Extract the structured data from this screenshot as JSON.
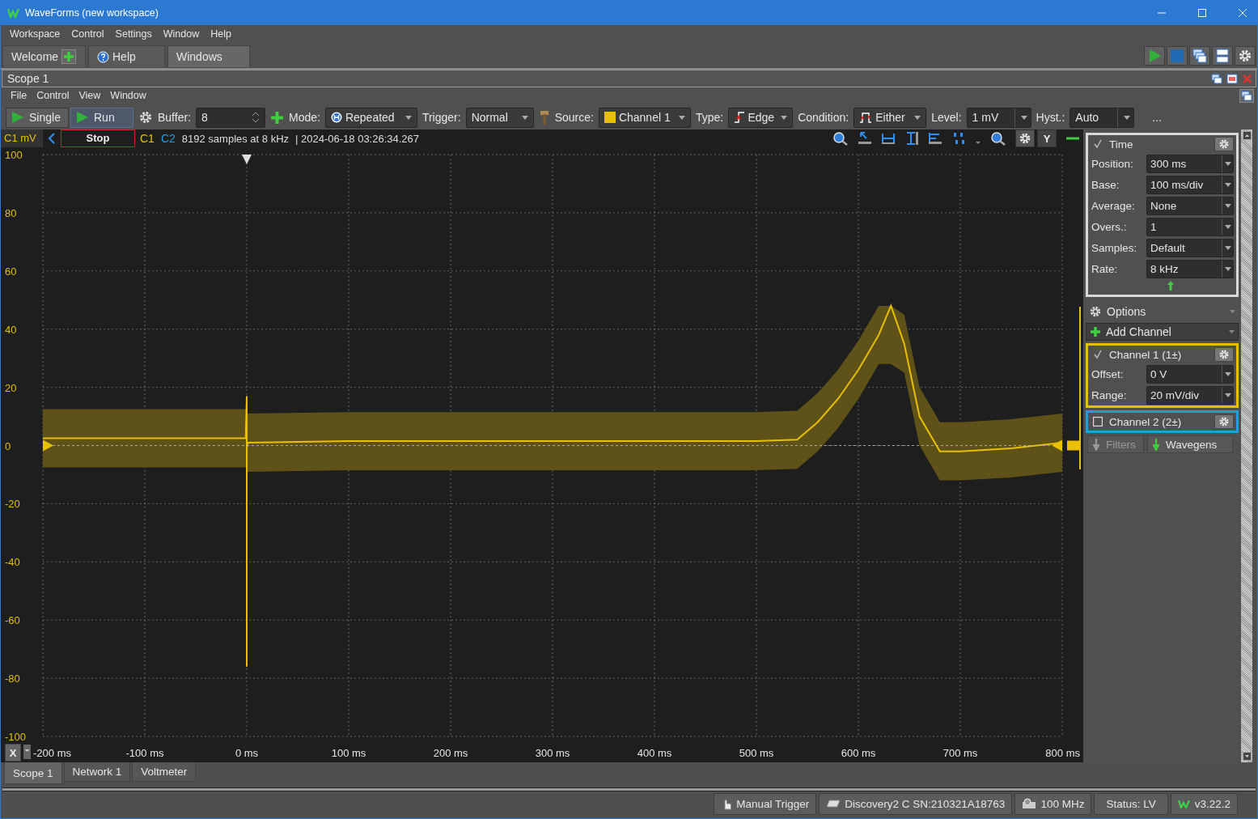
{
  "window": {
    "title": "WaveForms (new workspace)"
  },
  "menu": [
    "Workspace",
    "Control",
    "Settings",
    "Window",
    "Help"
  ],
  "tabs": [
    {
      "label": "Welcome",
      "selected": false,
      "kind": "add"
    },
    {
      "label": "Help",
      "selected": false,
      "kind": "help"
    },
    {
      "label": "Windows",
      "selected": true,
      "kind": "plain"
    }
  ],
  "scope": {
    "title": "Scope 1",
    "menu": [
      "File",
      "Control",
      "View",
      "Window"
    ],
    "toolbar": {
      "single": "Single",
      "run": "Run",
      "buffer_label": "Buffer:",
      "buffer": "8",
      "mode_label": "Mode:",
      "mode": "Repeated",
      "trigger_label": "Trigger:",
      "trigger": "Normal",
      "source_label": "Source:",
      "source": "Channel 1",
      "type_label": "Type:",
      "type": "Edge",
      "condition_label": "Condition:",
      "condition": "Either",
      "level_label": "Level:",
      "level_value": "1 mV",
      "hyst_label": "Hyst.:",
      "hyst": "Auto",
      "more": "..."
    },
    "info": {
      "status": "Stop",
      "channels": [
        {
          "label": "C1",
          "color": "#e8c000"
        },
        {
          "label": "C2",
          "color": "#1ba1e2"
        }
      ],
      "samples": "8192 samples at 8 kHz",
      "timestamp": "| 2024-06-18 03:26:34.267",
      "y_button": "Y",
      "x_button": "X"
    },
    "chart_data": {
      "type": "line",
      "ylabel": "C1 mV",
      "grid": true,
      "ref_lines": [
        {
          "axis": "y",
          "value": 0
        }
      ],
      "xlim": [
        -200,
        800
      ],
      "ylim": [
        -100,
        100
      ],
      "xticks": [
        {
          "value": -200,
          "label": "-200 ms"
        },
        {
          "value": -100,
          "label": "-100 ms"
        },
        {
          "value": 0,
          "label": "0 ms"
        },
        {
          "value": 100,
          "label": "100 ms"
        },
        {
          "value": 200,
          "label": "200 ms"
        },
        {
          "value": 300,
          "label": "300 ms"
        },
        {
          "value": 400,
          "label": "400 ms"
        },
        {
          "value": 500,
          "label": "500 ms"
        },
        {
          "value": 600,
          "label": "600 ms"
        },
        {
          "value": 700,
          "label": "700 ms"
        },
        {
          "value": 800,
          "label": "800 ms"
        }
      ],
      "yticks": [
        100,
        80,
        60,
        40,
        20,
        0,
        -20,
        -40,
        -60,
        -80,
        -100
      ],
      "x": [
        -200,
        -100,
        -1,
        0,
        0,
        0,
        1,
        100,
        200,
        300,
        400,
        500,
        540,
        560,
        580,
        600,
        620,
        632,
        645,
        660,
        680,
        700,
        750,
        800
      ],
      "series": [
        {
          "color": "#e8c000",
          "values": [
            2.5,
            2.5,
            2.5,
            17,
            -76,
            -1,
            1,
            1.5,
            1.5,
            1.5,
            1.5,
            1.5,
            2,
            8,
            16,
            26,
            38,
            48,
            35,
            10,
            -2,
            -2,
            -1,
            1
          ]
        }
      ]
    },
    "panel": {
      "time": {
        "title": "Time",
        "checked": true,
        "fields": [
          {
            "label": "Position:",
            "value": "300 ms"
          },
          {
            "label": "Base:",
            "value": "100 ms/div"
          },
          {
            "label": "Average:",
            "value": "None"
          },
          {
            "label": "Overs.:",
            "value": "1"
          },
          {
            "label": "Samples:",
            "value": "Default"
          },
          {
            "label": "Rate:",
            "value": "8 kHz"
          }
        ]
      },
      "options": "Options",
      "add_channel": "Add Channel",
      "channels": [
        {
          "title": "Channel 1 (1±)",
          "checked": true,
          "color": "#e8c000",
          "fields": [
            {
              "label": "Offset:",
              "value": "0 V"
            },
            {
              "label": "Range:",
              "value": "20 mV/div"
            }
          ]
        },
        {
          "title": "Channel 2 (2±)",
          "checked": false,
          "color": "#1ba1e2"
        }
      ],
      "filters": "Filters",
      "wavegens": "Wavegens"
    }
  },
  "bottom_tabs": [
    {
      "label": "Scope 1",
      "selected": true
    },
    {
      "label": "Network 1",
      "selected": false
    },
    {
      "label": "Voltmeter",
      "selected": false
    }
  ],
  "status_bar": [
    {
      "kind": "trigger",
      "label": "Manual Trigger"
    },
    {
      "kind": "device",
      "label": "Discovery2 C SN:210321A18763"
    },
    {
      "kind": "clock",
      "label": "100 MHz"
    },
    {
      "kind": "status",
      "label": "Status: LV"
    },
    {
      "kind": "version",
      "label": "v3.22.2"
    }
  ]
}
